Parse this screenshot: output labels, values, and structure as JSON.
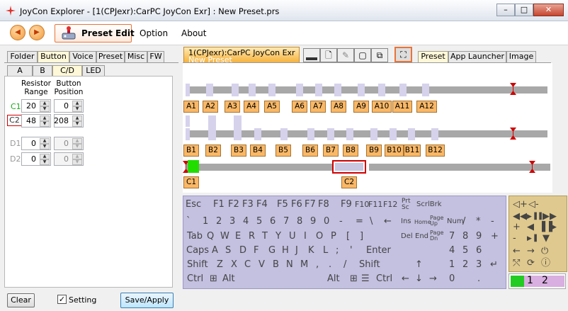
{
  "window": {
    "title": "JoyCon Explorer - [1(CPJexr):CarPC JoyCon Exr] : New Preset.prs",
    "minimize": "–",
    "maximize": "□",
    "close": "✕"
  },
  "menu": {
    "back": "◀",
    "forward": "▶",
    "preset_edit": "Preset Edit",
    "option": "Option",
    "about": "About"
  },
  "left_tabs": [
    "Folder",
    "Button",
    "Voice",
    "Preset",
    "Misc",
    "FW"
  ],
  "left_tab_selected": "Button",
  "sub_tabs": [
    "A",
    "B",
    "C/D",
    "LED"
  ],
  "sub_tab_selected": "C/D",
  "headers": {
    "resistor_range": "Resistor\nRange",
    "button_position": "Button\nPosition"
  },
  "rows": [
    {
      "label": "C1",
      "range": "20",
      "position": "0",
      "enabled": true
    },
    {
      "label": "C2",
      "range": "48",
      "position": "208",
      "enabled": true
    },
    {
      "label": "D1",
      "range": "0",
      "position": "0",
      "enabled": false
    },
    {
      "label": "D2",
      "range": "0",
      "position": "0",
      "enabled": false
    }
  ],
  "bottom": {
    "clear": "Clear",
    "setting": "Setting",
    "setting_checked": true,
    "save_apply": "Save/Apply"
  },
  "device": {
    "name": "1(CPJexr):CarPC JoyCon Exr",
    "preset": "New Preset"
  },
  "right_tabs": [
    "Preset",
    "App Launcher",
    "Image"
  ],
  "right_tab_selected": "Preset",
  "row_a": [
    "A1",
    "A2",
    "A3",
    "A4",
    "A5",
    "A6",
    "A7",
    "A8",
    "A9",
    "A10",
    "A11",
    "A12"
  ],
  "row_b": [
    "B1",
    "B2",
    "B3",
    "B4",
    "B5",
    "B6",
    "B7",
    "B8",
    "B9",
    "B10",
    "B11",
    "B12"
  ],
  "row_c": [
    "C1",
    "C2"
  ],
  "keyboard": {
    "r1": [
      "Esc",
      "F1",
      "F2",
      "F3",
      "F4",
      "F5",
      "F6",
      "F7",
      "F8",
      "F9",
      "F10",
      "F11",
      "F12",
      "Prt Sc",
      "ScrlBrk"
    ],
    "r2": [
      "`",
      "1",
      "2",
      "3",
      "4",
      "5",
      "6",
      "7",
      "8",
      "9",
      "0",
      "-",
      "=",
      "\\",
      "←",
      "Ins",
      "Home",
      "Page Up",
      "Num",
      "/",
      "*",
      "-"
    ],
    "r3": [
      "Tab",
      "Q",
      "W",
      "E",
      "R",
      "T",
      "Y",
      "U",
      "I",
      "O",
      "P",
      "[",
      "]",
      "Del",
      "End",
      "Page Dn",
      "7",
      "8",
      "9",
      "+"
    ],
    "r4": [
      "Caps",
      "A",
      "S",
      "D",
      "F",
      "G",
      "H",
      "J",
      "K",
      "L",
      ";",
      "'",
      "Enter",
      "4",
      "5",
      "6"
    ],
    "r5": [
      "Shift",
      "Z",
      "X",
      "C",
      "V",
      "B",
      "N",
      "M",
      ",",
      ".",
      "/",
      "Shift",
      "↑",
      "1",
      "2",
      "3",
      "↵"
    ],
    "r6": [
      "Ctrl",
      "⊞",
      "Alt",
      "Alt",
      "⊞",
      "☰",
      "Ctrl",
      "←",
      "↓",
      "→",
      "0",
      "."
    ]
  },
  "media_keys": [
    "◁+",
    "◁-",
    "◀◀",
    "▶▐▐",
    "▶▶",
    "+",
    "◀",
    "▐▐",
    "▶",
    "-",
    "▶▐",
    "▼",
    "←",
    "→",
    "⏻",
    "⤲",
    "⟳",
    "ⓘ"
  ],
  "pages": [
    "1",
    "2"
  ],
  "colors": {
    "label_orange": "#f9b867",
    "c1_green": "#22dd00",
    "selected_red": "#d00000",
    "keyboard_purple": "#c3c0e0",
    "numpad_tan": "#e0c98e"
  }
}
